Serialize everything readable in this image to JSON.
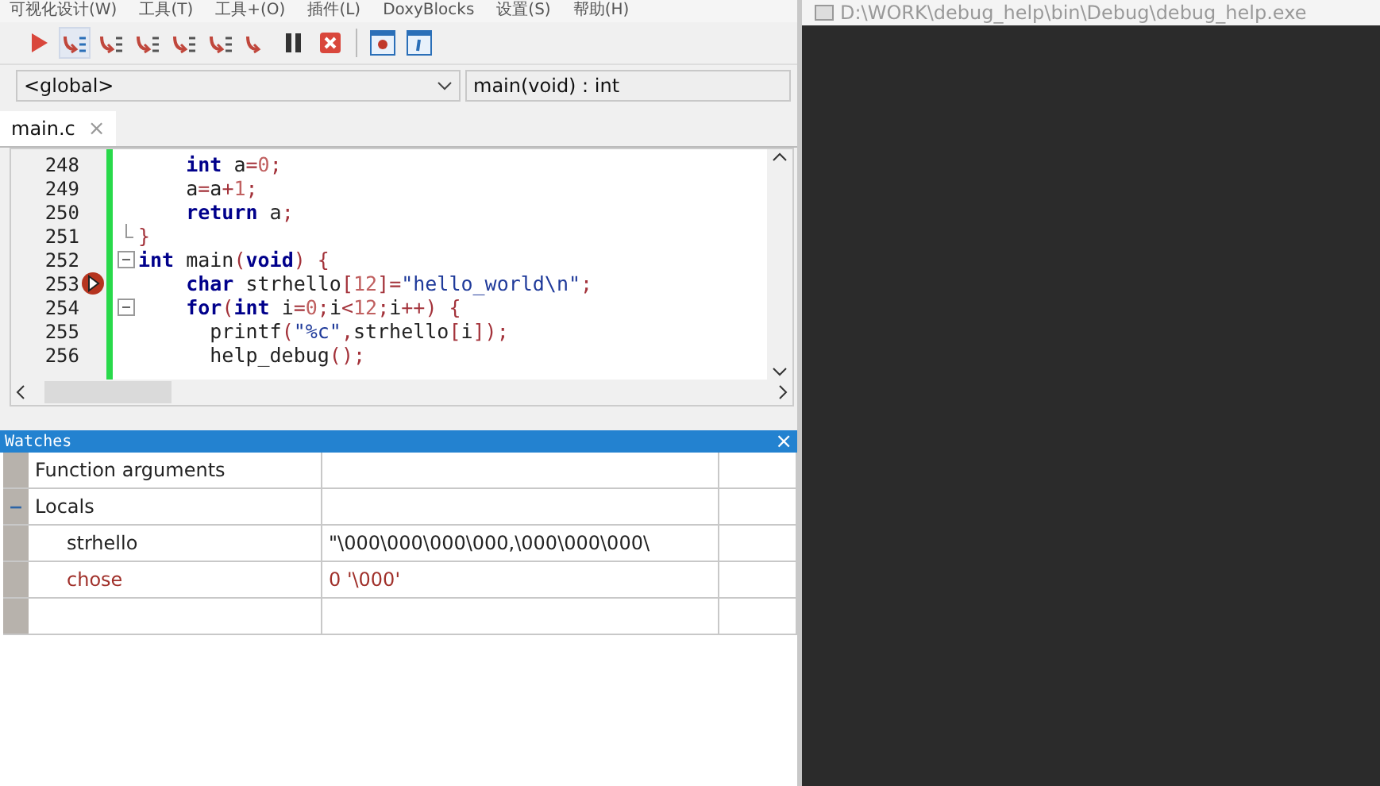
{
  "menu": [
    "可视化设计(W)",
    "工具(T)",
    "工具+(O)",
    "插件(L)",
    "DoxyBlocks",
    "设置(S)",
    "帮助(H)"
  ],
  "toolbar": [
    {
      "kind": "run"
    },
    {
      "kind": "next-line",
      "selected": true
    },
    {
      "kind": "step-into"
    },
    {
      "kind": "next-instruction"
    },
    {
      "kind": "step-out"
    },
    {
      "kind": "step-into-instruction"
    },
    {
      "kind": "run-to-cursor"
    },
    {
      "kind": "pause"
    },
    {
      "kind": "stop"
    },
    {
      "kind": "sep"
    },
    {
      "kind": "debug-window"
    },
    {
      "kind": "info"
    }
  ],
  "scope_combo": {
    "value": "<global>"
  },
  "function_combo": {
    "value": "main(void) : int"
  },
  "tabs": [
    {
      "label": "main.c",
      "selected": true,
      "close": "×"
    }
  ],
  "editor": {
    "lines": [
      {
        "number": "248",
        "breakpoint": false,
        "fold_box": false,
        "block_end": false,
        "tokens": [
          {
            "kind": "kw",
            "text": "    int"
          },
          {
            "kind": "id",
            "text": " a"
          },
          {
            "kind": "op",
            "text": "="
          },
          {
            "kind": "num",
            "text": "0"
          },
          {
            "kind": "op",
            "text": ";"
          }
        ]
      },
      {
        "number": "249",
        "breakpoint": false,
        "fold_box": false,
        "block_end": false,
        "tokens": [
          {
            "kind": "id",
            "text": "    a"
          },
          {
            "kind": "op",
            "text": "="
          },
          {
            "kind": "id",
            "text": "a"
          },
          {
            "kind": "op",
            "text": "+"
          },
          {
            "kind": "num",
            "text": "1"
          },
          {
            "kind": "op",
            "text": ";"
          }
        ]
      },
      {
        "number": "250",
        "breakpoint": false,
        "fold_box": false,
        "block_end": false,
        "tokens": [
          {
            "kind": "kw",
            "text": "    return"
          },
          {
            "kind": "id",
            "text": " a"
          },
          {
            "kind": "op",
            "text": ";"
          }
        ]
      },
      {
        "number": "251",
        "breakpoint": false,
        "fold_box": false,
        "block_end": true,
        "tokens": [
          {
            "kind": "op",
            "text": "}"
          }
        ]
      },
      {
        "number": "252",
        "breakpoint": false,
        "fold_box": true,
        "block_end": false,
        "tokens": [
          {
            "kind": "kw",
            "text": "int"
          },
          {
            "kind": "id",
            "text": " main"
          },
          {
            "kind": "op",
            "text": "("
          },
          {
            "kind": "kw",
            "text": "void"
          },
          {
            "kind": "op",
            "text": ") {"
          }
        ]
      },
      {
        "number": "253",
        "breakpoint": true,
        "fold_box": false,
        "block_end": false,
        "tokens": [
          {
            "kind": "kw",
            "text": "    char"
          },
          {
            "kind": "id",
            "text": " strhello"
          },
          {
            "kind": "op",
            "text": "["
          },
          {
            "kind": "num",
            "text": "12"
          },
          {
            "kind": "op",
            "text": "]="
          },
          {
            "kind": "str",
            "text": "\"hello_world\\n\""
          },
          {
            "kind": "op",
            "text": ";"
          }
        ]
      },
      {
        "number": "254",
        "breakpoint": false,
        "fold_box": true,
        "block_end": false,
        "tokens": [
          {
            "kind": "kw",
            "text": "    for"
          },
          {
            "kind": "op",
            "text": "("
          },
          {
            "kind": "kw",
            "text": "int"
          },
          {
            "kind": "id",
            "text": " i"
          },
          {
            "kind": "op",
            "text": "="
          },
          {
            "kind": "num",
            "text": "0"
          },
          {
            "kind": "op",
            "text": ";"
          },
          {
            "kind": "id",
            "text": "i"
          },
          {
            "kind": "op",
            "text": "<"
          },
          {
            "kind": "num",
            "text": "12"
          },
          {
            "kind": "op",
            "text": ";"
          },
          {
            "kind": "id",
            "text": "i"
          },
          {
            "kind": "op",
            "text": "++) {"
          }
        ]
      },
      {
        "number": "255",
        "breakpoint": false,
        "fold_box": false,
        "block_end": false,
        "tokens": [
          {
            "kind": "id",
            "text": "      printf"
          },
          {
            "kind": "op",
            "text": "("
          },
          {
            "kind": "str",
            "text": "\"%c\""
          },
          {
            "kind": "op",
            "text": ","
          },
          {
            "kind": "id",
            "text": "strhello"
          },
          {
            "kind": "op",
            "text": "["
          },
          {
            "kind": "id",
            "text": "i"
          },
          {
            "kind": "op",
            "text": "]);"
          }
        ]
      },
      {
        "number": "256",
        "breakpoint": false,
        "fold_box": false,
        "block_end": false,
        "tokens": [
          {
            "kind": "id",
            "text": "      help_debug"
          },
          {
            "kind": "op",
            "text": "();"
          }
        ]
      }
    ]
  },
  "watches": {
    "title": "Watches",
    "close": "×",
    "rows": [
      {
        "name": "Function arguments",
        "changed": false
      },
      {
        "name": "Locals",
        "expanded": true,
        "expander": "−",
        "changed": false,
        "children": [
          {
            "name": "strhello",
            "value": "\"\\000\\000\\000\\000,\\000\\000\\000\\",
            "changed": false
          },
          {
            "name": "chose",
            "value": "0 '\\000'",
            "changed": true
          }
        ]
      }
    ]
  },
  "console": {
    "title": "D:\\WORK\\debug_help\\bin\\Debug\\debug_help.exe"
  }
}
